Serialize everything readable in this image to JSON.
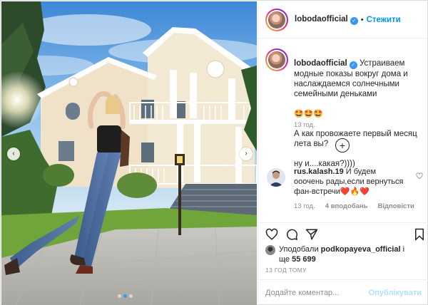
{
  "post": {
    "username": "lobodaofficial",
    "separator": "•",
    "follow_label": "Стежити",
    "verified_glyph": "✓"
  },
  "caption": {
    "username": "lobodaofficial",
    "line1": " Устраиваем модные показы вокруг дома и наслаждаемся солнечными семейными деньками",
    "emojis": "🤩🤩🤩",
    "line2": "А как провожаете первый месяц лета вы?",
    "line3": "ну и....какая?))))",
    "time": "13 год."
  },
  "load_more_glyph": "+",
  "comment": {
    "username": "rus.kalash.19",
    "text": " И будем ооочень рады,если вернуться фан-встречи",
    "emojis": "❤️🔥❤️",
    "time": "13 год.",
    "likes": "4 вподобань",
    "reply": "Відповісти"
  },
  "likes": {
    "prefix": "Уподобали",
    "user": "podkopayeva_official",
    "middle": " і",
    "line2_prefix": "ще",
    "count": "55 699"
  },
  "post_date": "13 ГОД ТОМУ",
  "comment_box": {
    "placeholder": "Додайте коментар...",
    "publish_label": "Опублікувати"
  },
  "carousel": {
    "prev_glyph": "‹",
    "next_glyph": "›",
    "slides": 3,
    "active_slide": 2
  },
  "colors": {
    "accent": "#0095f6",
    "verified": "#3897f0",
    "muted": "#8e8e8e",
    "publish_disabled": "#b2dffc"
  }
}
